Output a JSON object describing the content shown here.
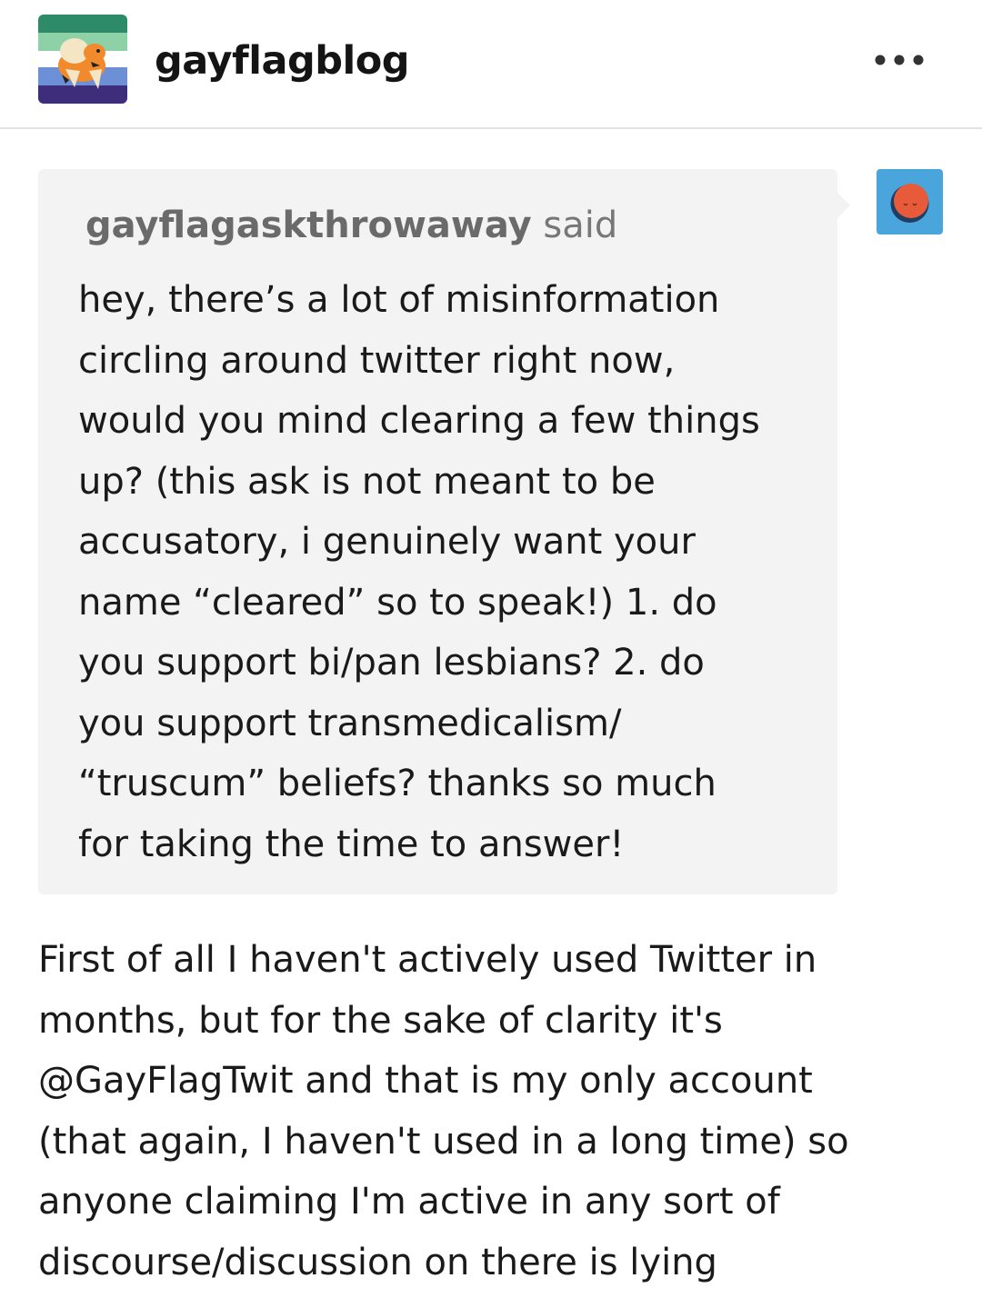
{
  "post": {
    "blog_name": "gayflagblog",
    "avatar_icon": "arcanine-on-flag-icon",
    "more_icon": "more-horizontal-icon"
  },
  "ask": {
    "asker": "gayflagaskthrowaway",
    "said_label": "said",
    "asker_avatar_icon": "anonymous-face-icon",
    "lines": [
      "hey, there’s a lot of misinformation",
      "circling around twitter right now,",
      "would you mind clearing a few things",
      "up? (this ask is not meant to be",
      "accusatory, i genuinely want your",
      "name “cleared” so to speak!) 1. do",
      "you support bi/pan lesbians? 2. do",
      "you support transmedicalism/",
      "“truscum” beliefs? thanks so much",
      "for taking the time to answer!"
    ]
  },
  "answer": {
    "lines": [
      "First of all I haven't actively used Twitter in",
      "months, but for the sake of clarity it's",
      "@GayFlagTwit and that is my only account",
      "(that again, I haven't used in a long time) so",
      "anyone claiming I'm active in any sort of",
      "discourse/discussion on there is lying"
    ]
  },
  "colors": {
    "ask_background": "#f3f3f3",
    "asker_avatar_background": "#4aa5dc",
    "divider": "#e2e2e2"
  }
}
